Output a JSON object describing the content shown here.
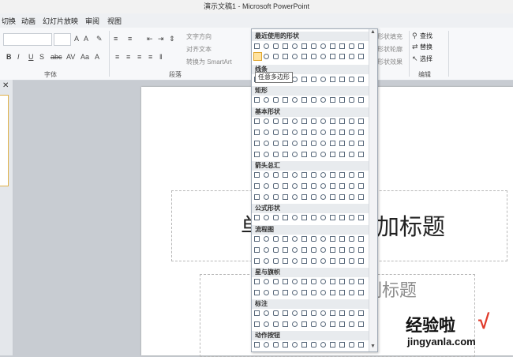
{
  "window": {
    "title": "演示文稿1 - Microsoft PowerPoint"
  },
  "tabs": [
    "切换",
    "动画",
    "幻灯片放映",
    "审阅",
    "视图"
  ],
  "ribbon": {
    "groups": {
      "font": "字体",
      "paragraph": "段落",
      "editing": "编辑"
    },
    "paragraph_cmds": {
      "text_direction": "文字方向",
      "align_text": "对齐文本",
      "smartart": "转换为 SmartArt"
    },
    "drawing_cmds": {
      "shape_fill": "形状填充",
      "shape_outline": "形状轮廓",
      "shape_effects": "形状效果"
    },
    "editing_cmds": {
      "find": "查找",
      "replace": "替换",
      "select": "选择"
    }
  },
  "gallery": {
    "categories": [
      "最近使用的形状",
      "线条",
      "矩形",
      "基本形状",
      "箭头总汇",
      "公式形状",
      "流程图",
      "星与旗帜",
      "标注",
      "动作按钮"
    ],
    "tooltip": "任意多边形"
  },
  "slide": {
    "title_left": "单",
    "title_right": "加标题",
    "subtitle": "副标题"
  },
  "watermark": {
    "main": "经验啦",
    "check": "√",
    "url": "jingyanla.com"
  }
}
